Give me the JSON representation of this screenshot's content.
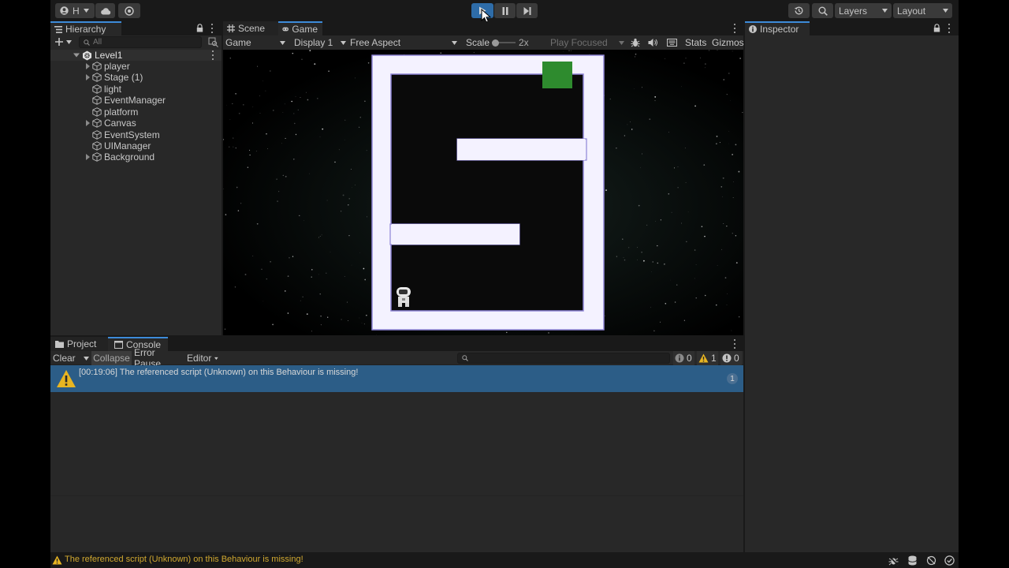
{
  "toolbar": {
    "account_initial": "H",
    "layers_label": "Layers",
    "layout_label": "Layout"
  },
  "hierarchy": {
    "tab_label": "Hierarchy",
    "search_placeholder": "All",
    "scene_name": "Level1",
    "items": [
      {
        "label": "player",
        "expandable": true
      },
      {
        "label": "Stage (1)",
        "expandable": true
      },
      {
        "label": "light",
        "expandable": false
      },
      {
        "label": "EventManager",
        "expandable": false
      },
      {
        "label": "platform",
        "expandable": false
      },
      {
        "label": "Canvas",
        "expandable": true
      },
      {
        "label": "EventSystem",
        "expandable": false
      },
      {
        "label": "UIManager",
        "expandable": false
      },
      {
        "label": "Background",
        "expandable": true
      }
    ]
  },
  "view_tabs": {
    "scene_label": "Scene",
    "game_label": "Game"
  },
  "game_toolbar": {
    "mode_label": "Game",
    "display_label": "Display 1",
    "aspect_label": "Free Aspect",
    "scale_label": "Scale",
    "scale_value": "2x",
    "play_focused_label": "Play Focused",
    "stats_label": "Stats",
    "gizmos_label": "Gizmos"
  },
  "inspector": {
    "tab_label": "Inspector"
  },
  "bottom_tabs": {
    "project_label": "Project",
    "console_label": "Console"
  },
  "console": {
    "clear_label": "Clear",
    "collapse_label": "Collapse",
    "error_pause_label": "Error Pause",
    "editor_label": "Editor",
    "log_count": "0",
    "warning_count": "1",
    "error_count": "0",
    "entries": [
      {
        "text": "[00:19:06] The referenced script (Unknown) on this Behaviour is missing!",
        "count": "1",
        "level": "warning"
      }
    ]
  },
  "status_bar": {
    "message": "The referenced script (Unknown) on this Behaviour is missing!"
  },
  "colors": {
    "accent": "#3d8bd9",
    "selected_row": "#2c5d87",
    "warning": "#e8b521",
    "goal": "#2e8b2e",
    "maze_wall": "#f4f2ff",
    "maze_border": "#8e84d6"
  },
  "icons": [
    "account-icon",
    "cloud-icon",
    "collab-icon",
    "play-icon",
    "pause-icon",
    "step-icon",
    "history-icon",
    "search-icon",
    "warning-icon",
    "error-icon",
    "info-icon",
    "lock-icon",
    "cube-icon"
  ]
}
